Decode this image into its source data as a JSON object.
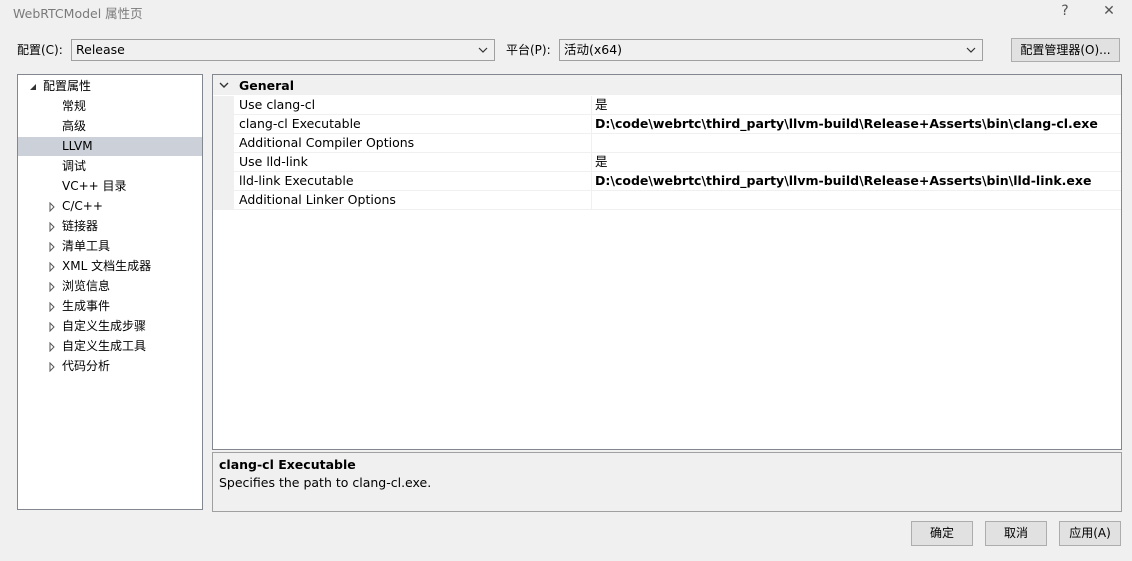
{
  "window": {
    "title": "WebRTCModel 属性页",
    "help_glyph": "?",
    "close_glyph": "✕"
  },
  "toolbar": {
    "config_label": "配置(C):",
    "config_value": "Release",
    "platform_label": "平台(P):",
    "platform_value": "活动(x64)",
    "config_manager_label": "配置管理器(O)..."
  },
  "tree": {
    "root": {
      "label": "配置属性",
      "expanded": true
    },
    "items": [
      {
        "label": "常规",
        "expandable": false,
        "selected": false
      },
      {
        "label": "高级",
        "expandable": false,
        "selected": false
      },
      {
        "label": "LLVM",
        "expandable": false,
        "selected": true
      },
      {
        "label": "调试",
        "expandable": false,
        "selected": false
      },
      {
        "label": "VC++ 目录",
        "expandable": false,
        "selected": false
      },
      {
        "label": "C/C++",
        "expandable": true,
        "selected": false
      },
      {
        "label": "链接器",
        "expandable": true,
        "selected": false
      },
      {
        "label": "清单工具",
        "expandable": true,
        "selected": false
      },
      {
        "label": "XML 文档生成器",
        "expandable": true,
        "selected": false
      },
      {
        "label": "浏览信息",
        "expandable": true,
        "selected": false
      },
      {
        "label": "生成事件",
        "expandable": true,
        "selected": false
      },
      {
        "label": "自定义生成步骤",
        "expandable": true,
        "selected": false
      },
      {
        "label": "自定义生成工具",
        "expandable": true,
        "selected": false
      },
      {
        "label": "代码分析",
        "expandable": true,
        "selected": false
      }
    ]
  },
  "grid": {
    "category": "General",
    "rows": [
      {
        "name": "Use clang-cl",
        "value": "是",
        "bold": false
      },
      {
        "name": "clang-cl Executable",
        "value": "D:\\code\\webrtc\\third_party\\llvm-build\\Release+Asserts\\bin\\clang-cl.exe",
        "bold": true
      },
      {
        "name": "Additional Compiler Options",
        "value": "",
        "bold": false
      },
      {
        "name": "Use lld-link",
        "value": "是",
        "bold": false
      },
      {
        "name": "lld-link Executable",
        "value": "D:\\code\\webrtc\\third_party\\llvm-build\\Release+Asserts\\bin\\lld-link.exe",
        "bold": true
      },
      {
        "name": "Additional Linker Options",
        "value": "",
        "bold": false
      }
    ]
  },
  "description": {
    "title": "clang-cl Executable",
    "text": "Specifies the path to clang-cl.exe."
  },
  "buttons": {
    "ok": "确定",
    "cancel": "取消",
    "apply": "应用(A)"
  },
  "colors": {
    "background": "#f0f0f0",
    "selected_item": "#ccd1d9",
    "border": "#828790"
  }
}
